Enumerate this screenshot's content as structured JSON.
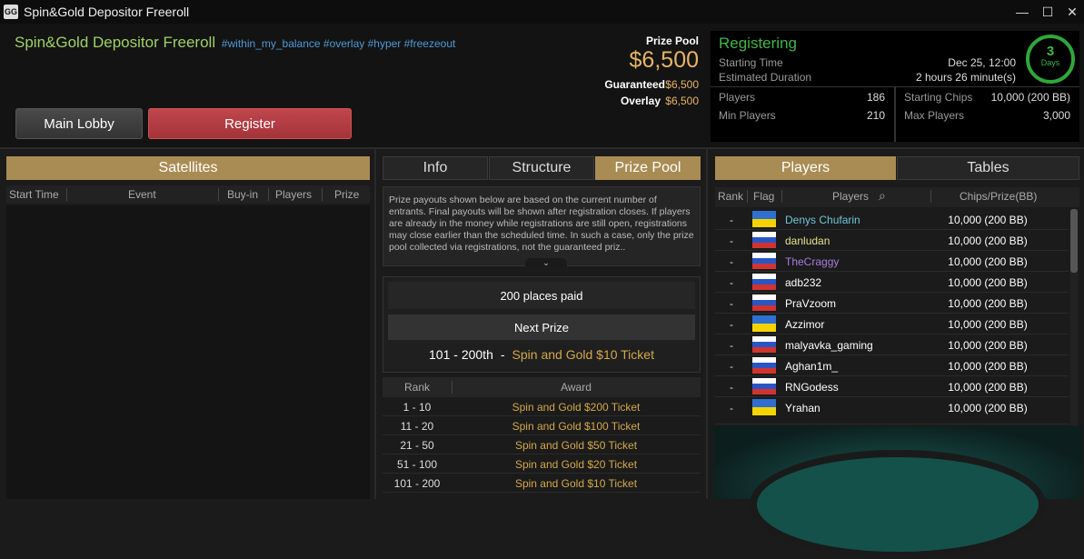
{
  "window": {
    "title": "Spin&Gold Depositor Freeroll",
    "logo_text": "GG",
    "controls": {
      "minimize": "—",
      "maximize": "☐",
      "close": "✕"
    }
  },
  "header": {
    "tournament_title": "Spin&Gold Depositor Freeroll",
    "tags": "#within_my_balance #overlay #hyper #freezeout",
    "prize_pool_label": "Prize Pool",
    "prize_pool_value": "$6,500",
    "guaranteed_label": "Guaranteed",
    "guaranteed_value": "$6,500",
    "overlay_label": "Overlay",
    "overlay_value": "$6,500",
    "main_lobby_label": "Main Lobby",
    "register_label": "Register"
  },
  "status": {
    "state": "Registering",
    "starting_time_label": "Starting Time",
    "starting_time_value": "Dec 25, 12:00",
    "duration_label": "Estimated Duration",
    "duration_value": "2 hours 26 minute(s)",
    "days_number": "3",
    "days_label": "Days",
    "players_label": "Players",
    "players_value": "186",
    "min_players_label": "Min Players",
    "min_players_value": "210",
    "starting_chips_label": "Starting Chips",
    "starting_chips_value": "10,000 (200 BB)",
    "max_players_label": "Max Players",
    "max_players_value": "3,000"
  },
  "satellites": {
    "title": "Satellites",
    "columns": [
      "Start Time",
      "Event",
      "Buy-in",
      "Players",
      "Prize"
    ]
  },
  "center": {
    "tabs": [
      "Info",
      "Structure",
      "Prize Pool"
    ],
    "active_tab": "Prize Pool",
    "notice": "Prize payouts shown below are based on the current number of entrants. Final payouts will be shown after registration closes. If players are already in the money while registrations are still open, registrations may close earlier than the scheduled time. In such a case, only the prize pool collected via registrations, not the guaranteed priz..",
    "places_paid": "200 places paid",
    "next_prize_label": "Next Prize",
    "next_prize_rank": "101 - 200th",
    "next_prize_dash": "-",
    "next_prize_award": "Spin and Gold $10 Ticket",
    "table_headers": {
      "rank": "Rank",
      "award": "Award"
    },
    "payouts": [
      {
        "rank": "1 - 10",
        "award": "Spin and Gold $200 Ticket"
      },
      {
        "rank": "11 - 20",
        "award": "Spin and Gold $100 Ticket"
      },
      {
        "rank": "21 - 50",
        "award": "Spin and Gold $50 Ticket"
      },
      {
        "rank": "51 - 100",
        "award": "Spin and Gold $20 Ticket"
      },
      {
        "rank": "101 - 200",
        "award": "Spin and Gold $10 Ticket"
      }
    ]
  },
  "players_panel": {
    "tabs": [
      "Players",
      "Tables"
    ],
    "active_tab": "Players",
    "columns": {
      "rank": "Rank",
      "flag": "Flag",
      "players": "Players",
      "chips": "Chips/Prize(BB)"
    },
    "rows": [
      {
        "rank": "-",
        "flag": "ua",
        "name": "Denys Chufarin",
        "color": "#6fc6d8",
        "chips": "10,000 (200 BB)"
      },
      {
        "rank": "-",
        "flag": "ru",
        "name": "danludan",
        "color": "#e6e08a",
        "chips": "10,000 (200 BB)"
      },
      {
        "rank": "-",
        "flag": "ru",
        "name": "TheCraggy",
        "color": "#a77ce0",
        "chips": "10,000 (200 BB)"
      },
      {
        "rank": "-",
        "flag": "ru",
        "name": "adb232",
        "color": "#ffffff",
        "chips": "10,000 (200 BB)"
      },
      {
        "rank": "-",
        "flag": "ru",
        "name": "PraVzoom",
        "color": "#ffffff",
        "chips": "10,000 (200 BB)"
      },
      {
        "rank": "-",
        "flag": "ua",
        "name": "Azzimor",
        "color": "#ffffff",
        "chips": "10,000 (200 BB)"
      },
      {
        "rank": "-",
        "flag": "ru",
        "name": "malyavka_gaming",
        "color": "#ffffff",
        "chips": "10,000 (200 BB)"
      },
      {
        "rank": "-",
        "flag": "ru",
        "name": "Aghan1m_",
        "color": "#ffffff",
        "chips": "10,000 (200 BB)"
      },
      {
        "rank": "-",
        "flag": "ru",
        "name": "RNGodess",
        "color": "#ffffff",
        "chips": "10,000 (200 BB)"
      },
      {
        "rank": "-",
        "flag": "ua",
        "name": "Yrahan",
        "color": "#ffffff",
        "chips": "10,000 (200 BB)"
      }
    ]
  },
  "colors": {
    "accent_gold": "#a98c53",
    "register_red": "#b23c42",
    "status_green": "#3fb548",
    "tag_blue": "#4d9ad6",
    "title_green": "#9fd166",
    "award_gold": "#d4a74a"
  }
}
